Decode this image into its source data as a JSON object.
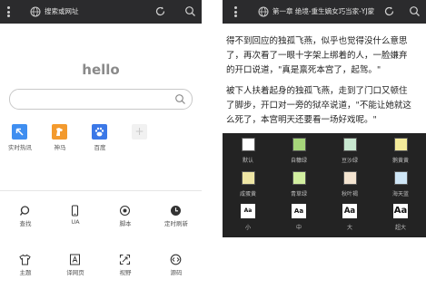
{
  "browser": {
    "address_placeholder": "搜索或网址",
    "hello": "hello",
    "search_placeholder": "",
    "shortcuts": [
      {
        "label": "实时热讯",
        "color": "#3f8ef0",
        "icon": "arrow-up-left-icon"
      },
      {
        "label": "神马",
        "color": "#f39a2e",
        "icon": "horse-icon"
      },
      {
        "label": "百度",
        "color": "#3b78e7",
        "icon": "paw-icon"
      }
    ],
    "add_symbol": "+",
    "menu_row1": [
      {
        "label": "查找",
        "icon": "find-icon"
      },
      {
        "label": "UA",
        "icon": "phone-icon"
      },
      {
        "label": "脚本",
        "icon": "script-icon"
      },
      {
        "label": "定时刷新",
        "icon": "clock-icon"
      }
    ],
    "menu_row2": [
      {
        "label": "主题",
        "icon": "shirt-icon"
      },
      {
        "label": "译网页",
        "icon": "translate-icon"
      },
      {
        "label": "视野",
        "icon": "expand-icon"
      },
      {
        "label": "源码",
        "icon": "code-icon"
      }
    ]
  },
  "reader": {
    "address": "第一章 绝境-重生嫡女巧当家-YJ蒙",
    "paragraphs": [
      "得不到回应的独孤飞燕，似乎也觉得没什么意思",
      "了，再次看了一眼十字架上绑着的人，一脸嫌弃",
      "的开口说道，\"真是禀死本宫了，起驾。\"",
      "被下人扶着起身的独孤飞燕，走到了门口又顿住",
      "了脚步，开口对一旁的狱卒说道，\"不能让她就这",
      "么死了，本宫明天还要看一场好戏呢。\""
    ],
    "themes_row1": [
      {
        "name": "默认",
        "color": "#ffffff"
      },
      {
        "name": "自糠绿",
        "color": "#a6d67a"
      },
      {
        "name": "豆沙绿",
        "color": "#c8e8d0"
      },
      {
        "name": "鹅黄黄",
        "color": "#f4eb9a"
      }
    ],
    "themes_row2": [
      {
        "name": "咸蛋黄",
        "color": "#eee6a5"
      },
      {
        "name": "青草绿",
        "color": "#d2efa0"
      },
      {
        "name": "秋叶褐",
        "color": "#f3e4d0"
      },
      {
        "name": "海天蓝",
        "color": "#cfe6f6"
      }
    ],
    "font_sizes": [
      {
        "sample": "Aa",
        "name": "小"
      },
      {
        "sample": "Aa",
        "name": "中"
      },
      {
        "sample": "Aa",
        "name": "大"
      },
      {
        "sample": "Aa",
        "name": "超大"
      }
    ]
  }
}
